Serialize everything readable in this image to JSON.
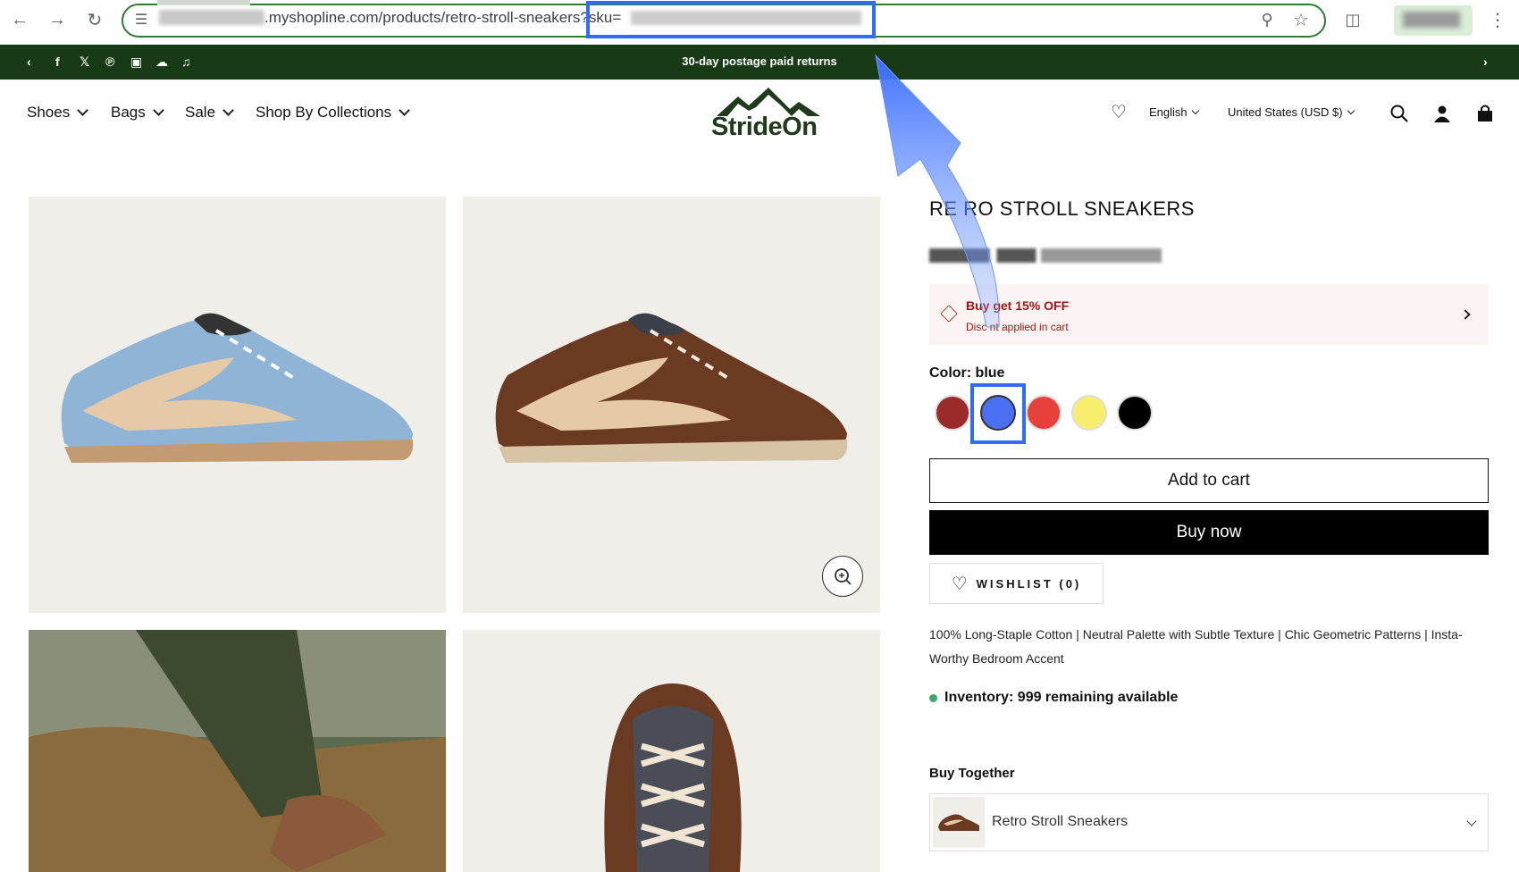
{
  "browser": {
    "url_domain": ".myshopline.com/products/retro-stroll-sneakers",
    "url_query": "?sku=",
    "back_icon": "arrow-left-icon",
    "forward_icon": "arrow-right-icon",
    "reload_icon": "reload-icon"
  },
  "announcement": {
    "text": "30-day postage paid returns"
  },
  "nav": {
    "items": [
      {
        "label": "Shoes"
      },
      {
        "label": "Bags"
      },
      {
        "label": "Sale"
      },
      {
        "label": "Shop By Collections"
      }
    ],
    "logo_text": "StrideOn",
    "language": "English",
    "currency": "United States (USD $)"
  },
  "product": {
    "title": "RE  RO STROLL SNEAKERS",
    "promo_title": "Buy  get 15% OFF",
    "promo_sub": "Disc  nt applied in cart",
    "color_label": "Color: blue",
    "swatches": [
      "#9b2a2a",
      "#4a6ff0",
      "#e8403a",
      "#f7ee6e",
      "#000000"
    ],
    "selected_swatch": 1,
    "add_to_cart": "Add to cart",
    "buy_now": "Buy now",
    "wishlist": "WISHLIST (0)",
    "description": "100% Long-Staple Cotton | Neutral Palette with Subtle Texture | Chic Geometric Patterns | Insta-Worthy Bedroom Accent",
    "inventory": "Inventory: 999 remaining available",
    "buy_together_title": "Buy Together",
    "bundle_label": "Retro Stroll Sneakers"
  },
  "colors": {
    "announcement_bg": "#183b16",
    "highlight": "#2f6bff",
    "promo_text": "#a31515"
  }
}
